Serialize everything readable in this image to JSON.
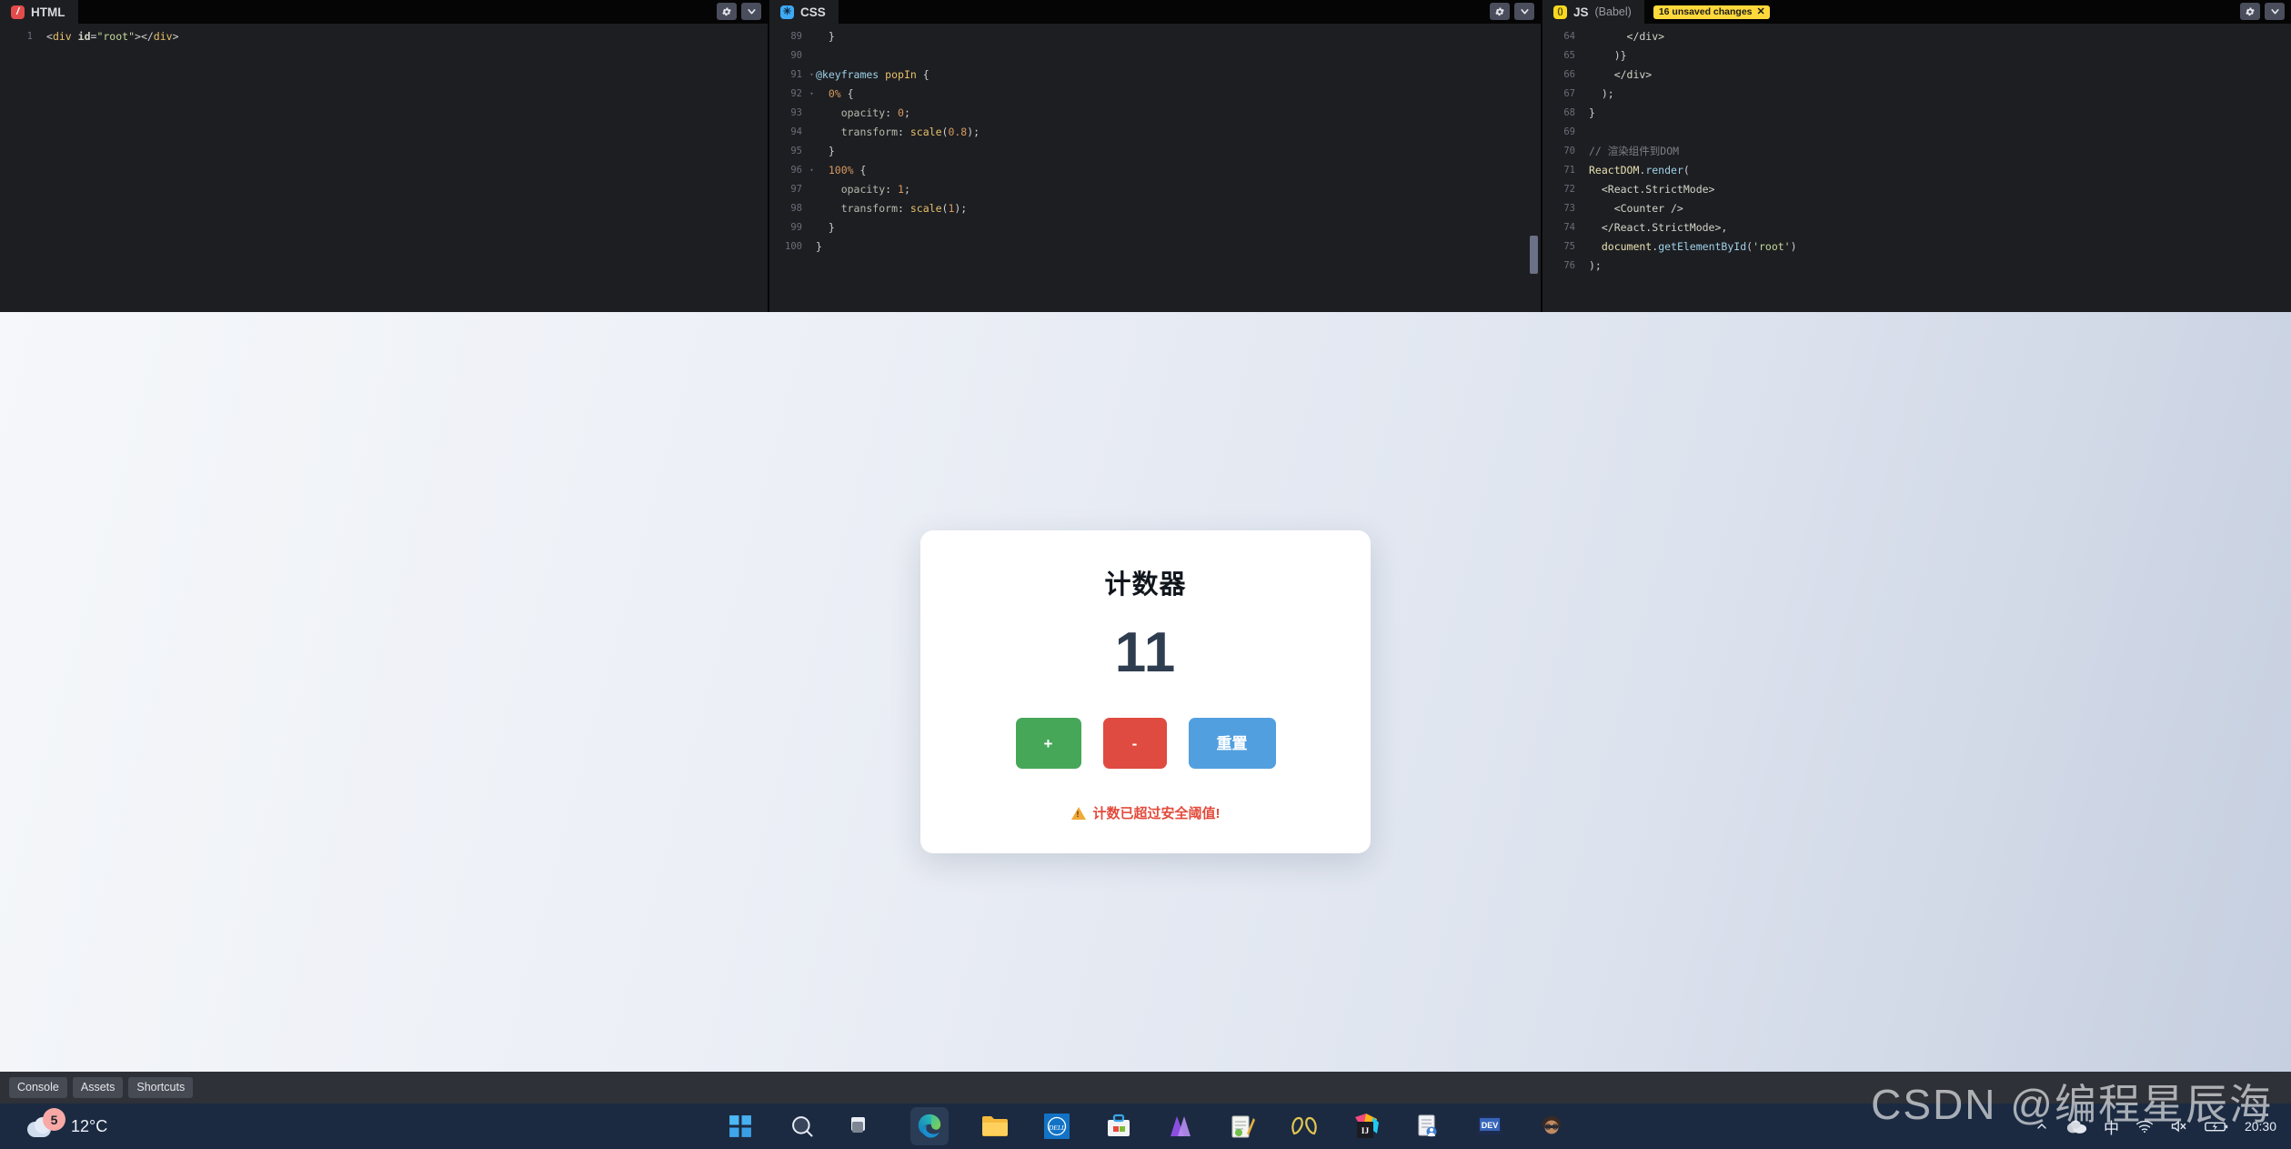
{
  "editor": {
    "panes": [
      {
        "lang_badge": "html-badge-icon",
        "title": "HTML",
        "sub": "",
        "unsaved": null,
        "lines": [
          {
            "num": "1",
            "fold": "",
            "tokens": [
              {
                "c": "t-punc",
                "t": "<"
              },
              {
                "c": "t-tag",
                "t": "div"
              },
              {
                "c": "t-punc",
                "t": " "
              },
              {
                "c": "t-attr",
                "t": "id"
              },
              {
                "c": "t-punc",
                "t": "="
              },
              {
                "c": "t-str",
                "t": "\"root\""
              },
              {
                "c": "t-punc",
                "t": ">"
              },
              {
                "c": "t-punc",
                "t": "</"
              },
              {
                "c": "t-tag",
                "t": "div"
              },
              {
                "c": "t-punc",
                "t": ">"
              }
            ]
          }
        ]
      },
      {
        "lang_badge": "css-badge-icon",
        "title": "CSS",
        "sub": "",
        "unsaved": null,
        "lines": [
          {
            "num": "89",
            "fold": "",
            "tokens": [
              {
                "c": "t-punc",
                "t": "  }"
              }
            ]
          },
          {
            "num": "90",
            "fold": "",
            "tokens": [
              {
                "c": "t-punc",
                "t": ""
              }
            ]
          },
          {
            "num": "91",
            "fold": "▾",
            "tokens": [
              {
                "c": "t-at",
                "t": "@keyframes"
              },
              {
                "c": "t-sel",
                "t": " popIn"
              },
              {
                "c": "t-punc",
                "t": " {"
              }
            ]
          },
          {
            "num": "92",
            "fold": "▾",
            "tokens": [
              {
                "c": "t-num",
                "t": "  0%"
              },
              {
                "c": "t-punc",
                "t": " {"
              }
            ]
          },
          {
            "num": "93",
            "fold": "",
            "tokens": [
              {
                "c": "t-prop",
                "t": "    opacity"
              },
              {
                "c": "t-punc",
                "t": ": "
              },
              {
                "c": "t-num",
                "t": "0"
              },
              {
                "c": "t-punc",
                "t": ";"
              }
            ]
          },
          {
            "num": "94",
            "fold": "",
            "tokens": [
              {
                "c": "t-prop",
                "t": "    transform"
              },
              {
                "c": "t-punc",
                "t": ": "
              },
              {
                "c": "t-fn",
                "t": "scale"
              },
              {
                "c": "t-punc",
                "t": "("
              },
              {
                "c": "t-num",
                "t": "0.8"
              },
              {
                "c": "t-punc",
                "t": ");"
              }
            ]
          },
          {
            "num": "95",
            "fold": "",
            "tokens": [
              {
                "c": "t-punc",
                "t": "  }"
              }
            ]
          },
          {
            "num": "96",
            "fold": "▾",
            "tokens": [
              {
                "c": "t-num",
                "t": "  100%"
              },
              {
                "c": "t-punc",
                "t": " {"
              }
            ]
          },
          {
            "num": "97",
            "fold": "",
            "tokens": [
              {
                "c": "t-prop",
                "t": "    opacity"
              },
              {
                "c": "t-punc",
                "t": ": "
              },
              {
                "c": "t-num",
                "t": "1"
              },
              {
                "c": "t-punc",
                "t": ";"
              }
            ]
          },
          {
            "num": "98",
            "fold": "",
            "tokens": [
              {
                "c": "t-prop",
                "t": "    transform"
              },
              {
                "c": "t-punc",
                "t": ": "
              },
              {
                "c": "t-fn",
                "t": "scale"
              },
              {
                "c": "t-punc",
                "t": "("
              },
              {
                "c": "t-num",
                "t": "1"
              },
              {
                "c": "t-punc",
                "t": ");"
              }
            ]
          },
          {
            "num": "99",
            "fold": "",
            "tokens": [
              {
                "c": "t-punc",
                "t": "  }"
              }
            ]
          },
          {
            "num": "100",
            "fold": "",
            "tokens": [
              {
                "c": "t-punc",
                "t": "}"
              }
            ]
          }
        ]
      },
      {
        "lang_badge": "js-badge-icon",
        "title": "JS",
        "sub": "(Babel)",
        "unsaved": "16 unsaved changes",
        "lines": [
          {
            "num": "64",
            "fold": "",
            "tokens": [
              {
                "c": "t-jsx",
                "t": "      </div>"
              }
            ]
          },
          {
            "num": "65",
            "fold": "",
            "tokens": [
              {
                "c": "t-punc",
                "t": "    )}"
              }
            ]
          },
          {
            "num": "66",
            "fold": "",
            "tokens": [
              {
                "c": "t-jsx",
                "t": "    </div>"
              }
            ]
          },
          {
            "num": "67",
            "fold": "",
            "tokens": [
              {
                "c": "t-punc",
                "t": "  );"
              }
            ]
          },
          {
            "num": "68",
            "fold": "",
            "tokens": [
              {
                "c": "t-punc",
                "t": "}"
              }
            ]
          },
          {
            "num": "69",
            "fold": "",
            "tokens": [
              {
                "c": "t-punc",
                "t": ""
              }
            ]
          },
          {
            "num": "70",
            "fold": "",
            "tokens": [
              {
                "c": "t-cmt",
                "t": "// 渲染组件到DOM"
              }
            ]
          },
          {
            "num": "71",
            "fold": "",
            "tokens": [
              {
                "c": "t-obj",
                "t": "ReactDOM"
              },
              {
                "c": "t-punc",
                "t": "."
              },
              {
                "c": "t-meth",
                "t": "render"
              },
              {
                "c": "t-punc",
                "t": "("
              }
            ]
          },
          {
            "num": "72",
            "fold": "",
            "tokens": [
              {
                "c": "t-jsx",
                "t": "  <React.StrictMode>"
              }
            ]
          },
          {
            "num": "73",
            "fold": "",
            "tokens": [
              {
                "c": "t-jsx",
                "t": "    <Counter />"
              }
            ]
          },
          {
            "num": "74",
            "fold": "",
            "tokens": [
              {
                "c": "t-jsx",
                "t": "  </React.StrictMode>"
              },
              {
                "c": "t-punc",
                "t": ","
              }
            ]
          },
          {
            "num": "75",
            "fold": "",
            "tokens": [
              {
                "c": "t-obj",
                "t": "  document"
              },
              {
                "c": "t-punc",
                "t": "."
              },
              {
                "c": "t-meth",
                "t": "getElementById"
              },
              {
                "c": "t-punc",
                "t": "("
              },
              {
                "c": "t-str",
                "t": "'root'"
              },
              {
                "c": "t-punc",
                "t": ")"
              }
            ]
          },
          {
            "num": "76",
            "fold": "",
            "tokens": [
              {
                "c": "t-punc",
                "t": ");"
              }
            ]
          }
        ]
      }
    ],
    "pane_actions": {
      "settings": "gear-icon",
      "collapse": "chevron-down-icon"
    }
  },
  "preview": {
    "card": {
      "title": "计数器",
      "value": "11",
      "buttons": [
        {
          "label": "+",
          "name": "increment-button",
          "cls": "inc",
          "color": "#46a758"
        },
        {
          "label": "-",
          "name": "decrement-button",
          "cls": "dec",
          "color": "#df4b40"
        },
        {
          "label": "重置",
          "name": "reset-button",
          "cls": "reset",
          "color": "#529fe0"
        }
      ],
      "warning": "计数已超过安全阈值!",
      "warning_color": "#e24b3c"
    }
  },
  "pen_bar": {
    "buttons": [
      "Console",
      "Assets",
      "Shortcuts"
    ]
  },
  "taskbar": {
    "weather": {
      "temperature": "12°C",
      "badge": "5"
    },
    "apps": [
      {
        "name": "start-button-icon"
      },
      {
        "name": "search-icon"
      },
      {
        "name": "task-view-icon"
      },
      {
        "name": "microsoft-edge-icon"
      },
      {
        "name": "file-explorer-icon"
      },
      {
        "name": "dell-icon"
      },
      {
        "name": "microsoft-store-icon"
      },
      {
        "name": "affinity-icon"
      },
      {
        "name": "notepad-icon"
      },
      {
        "name": "mongodb-compass-icon"
      },
      {
        "name": "intellij-idea-icon"
      },
      {
        "name": "sticky-notes-icon"
      },
      {
        "name": "dev-app-icon"
      },
      {
        "name": "user-avatar-icon"
      }
    ],
    "tray": {
      "items": [
        "chevron-up-icon",
        "onedrive-icon",
        "ime-chinese-icon",
        "wifi-icon",
        "speaker-muted-icon",
        "battery-charging-icon"
      ],
      "ime_label": "中",
      "clock": "20:30"
    }
  },
  "watermark": "CSDN @编程星辰海"
}
